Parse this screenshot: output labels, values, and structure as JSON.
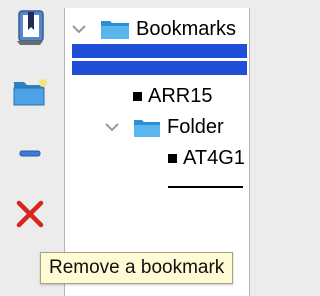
{
  "tree": {
    "root_label": "Bookmarks",
    "items": [
      {
        "label": "ARR15"
      },
      {
        "label": "Folder",
        "children": [
          {
            "label": "AT4G1"
          }
        ]
      }
    ]
  },
  "tooltip": {
    "text": "Remove a bookmark"
  },
  "toolbar": {
    "icons": [
      "add-bookmark-icon",
      "add-folder-icon",
      "add-separator-icon",
      "remove-icon"
    ]
  },
  "colors": {
    "selection": "#1f4fd8",
    "folder": "#39a6e8",
    "remove": "#d8261e",
    "separator": "#3f7bd6"
  }
}
